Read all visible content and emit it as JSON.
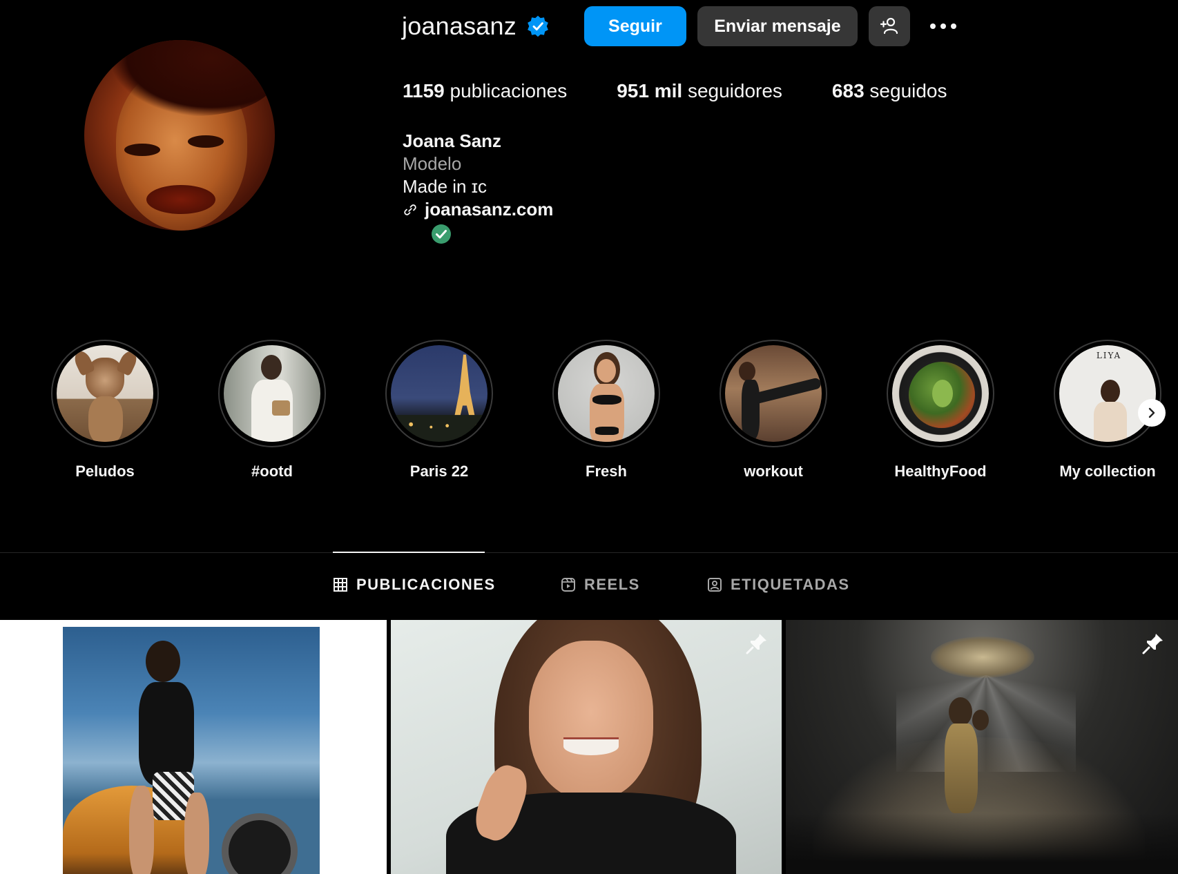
{
  "profile": {
    "username": "joanasanz",
    "verified": true,
    "follow_label": "Seguir",
    "message_label": "Enviar mensaje",
    "add_person_icon": "add-person-icon",
    "more_icon": "more-horizontal-icon"
  },
  "stats": {
    "posts_count": "1159",
    "posts_label": "publicaciones",
    "followers_count": "951 mil",
    "followers_label": "seguidores",
    "following_count": "683",
    "following_label": "seguidos"
  },
  "bio": {
    "name": "Joana Sanz",
    "category": "Modelo",
    "line": "Made in ɪc",
    "link": "joanasanz.com"
  },
  "highlights": [
    {
      "label": "Peludos"
    },
    {
      "label": "#ootd"
    },
    {
      "label": "Paris 22"
    },
    {
      "label": "Fresh"
    },
    {
      "label": "workout"
    },
    {
      "label": "HealthyFood"
    },
    {
      "label": "My collection"
    }
  ],
  "tabs": [
    {
      "label": "PUBLICACIONES",
      "icon": "grid-icon",
      "active": true
    },
    {
      "label": "REELS",
      "icon": "reels-icon",
      "active": false
    },
    {
      "label": "ETIQUETADAS",
      "icon": "tagged-icon",
      "active": false
    }
  ],
  "posts": [
    {
      "pinned": false
    },
    {
      "pinned": true
    },
    {
      "pinned": true
    }
  ],
  "colors": {
    "background": "#000000",
    "primary_button": "#0095f6",
    "secondary_button": "#363636",
    "verified_blue": "#0095f6",
    "check_green": "#3a9d6e",
    "muted_text": "#a8a8a8"
  }
}
